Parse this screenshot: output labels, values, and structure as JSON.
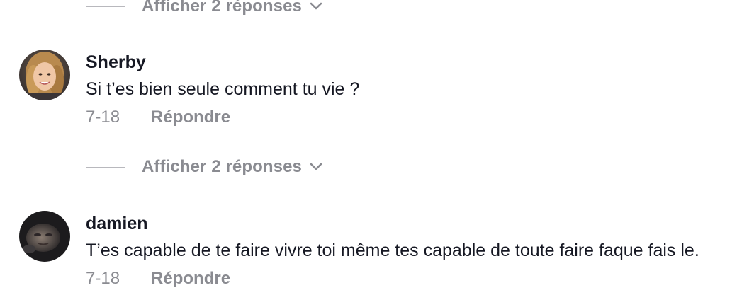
{
  "replies_toggle_label": "Afficher 2 réponses",
  "colors": {
    "text_primary": "#161823",
    "text_secondary": "#8a8b91",
    "divider": "#b8b8bd"
  },
  "icons": {
    "expand": "chevron-down-icon"
  },
  "comments": [
    {
      "username": "Sherby",
      "text": "Si t’es bien seule comment tu vie ?",
      "date": "7-18",
      "reply_label": "Répondre",
      "replies_label": "Afficher 2 réponses"
    },
    {
      "username": "damien",
      "text": "T’es capable de te faire vivre toi même tes capable de toute faire faque fais le.",
      "date": "7-18",
      "reply_label": "Répondre"
    }
  ]
}
